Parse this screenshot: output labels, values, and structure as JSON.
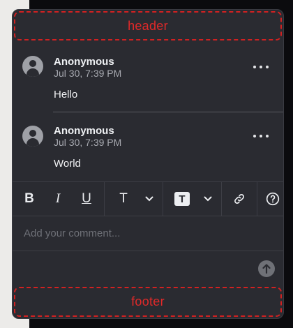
{
  "regions": {
    "header_label": "header",
    "footer_label": "footer"
  },
  "comments": [
    {
      "author": "Anonymous",
      "time": "Jul 30, 7:39 PM",
      "text": "Hello"
    },
    {
      "author": "Anonymous",
      "time": "Jul 30, 7:39 PM",
      "text": "World"
    }
  ],
  "toolbar": {
    "bold": "B",
    "italic": "I",
    "underline": "U",
    "text_color": "T",
    "background_color": "T",
    "link_icon": "link-icon",
    "help_icon": "help-icon"
  },
  "composer": {
    "placeholder": "Add your comment..."
  },
  "colors": {
    "panel": "#2a2b31",
    "accent_region": "#d22121"
  }
}
